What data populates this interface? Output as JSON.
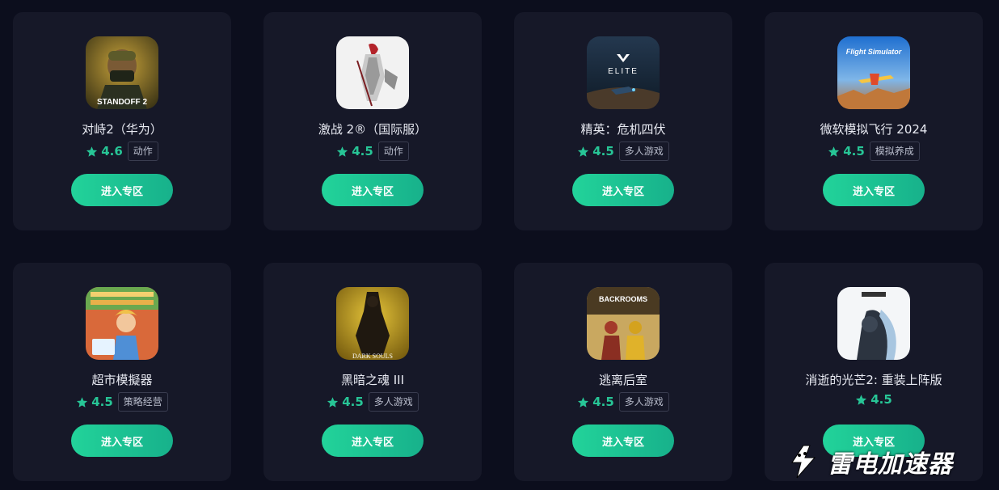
{
  "games": [
    {
      "name": "对峙2（华为）",
      "rating": "4.6",
      "tag": "动作",
      "button": "进入专区",
      "icon": "standoff-2-icon",
      "art": "STANDOFF 2"
    },
    {
      "name": "激战 2®（国际服）",
      "rating": "4.5",
      "tag": "动作",
      "button": "进入专区",
      "icon": "guild-wars-2-icon",
      "art": ""
    },
    {
      "name": "精英：危机四伏",
      "rating": "4.5",
      "tag": "多人游戏",
      "button": "进入专区",
      "icon": "elite-dangerous-icon",
      "art": "ELITE"
    },
    {
      "name": "微软模拟飞行 2024",
      "rating": "4.5",
      "tag": "模拟养成",
      "button": "进入专区",
      "icon": "flight-simulator-icon",
      "art": "Flight Simulator"
    },
    {
      "name": "超市模擬器",
      "rating": "4.5",
      "tag": "策略经营",
      "button": "进入专区",
      "icon": "supermarket-simulator-icon",
      "art": ""
    },
    {
      "name": "黑暗之魂 III",
      "rating": "4.5",
      "tag": "多人游戏",
      "button": "进入专区",
      "icon": "dark-souls-3-icon",
      "art": "DARK SOULS"
    },
    {
      "name": "逃离后室",
      "rating": "4.5",
      "tag": "多人游戏",
      "button": "进入专区",
      "icon": "escape-the-backrooms-icon",
      "art": "BACKROOMS"
    },
    {
      "name": "消逝的光芒2: 重装上阵版",
      "rating": "4.5",
      "tag": "",
      "button": "进入专区",
      "icon": "dying-light-2-icon",
      "art": ""
    }
  ],
  "brand": {
    "name": "雷电加速器",
    "icon": "lightning-logo-icon"
  },
  "colors": {
    "background": "#0c0e1d",
    "card": "#161828",
    "accent": "#22d39a",
    "star": "#27c596"
  }
}
